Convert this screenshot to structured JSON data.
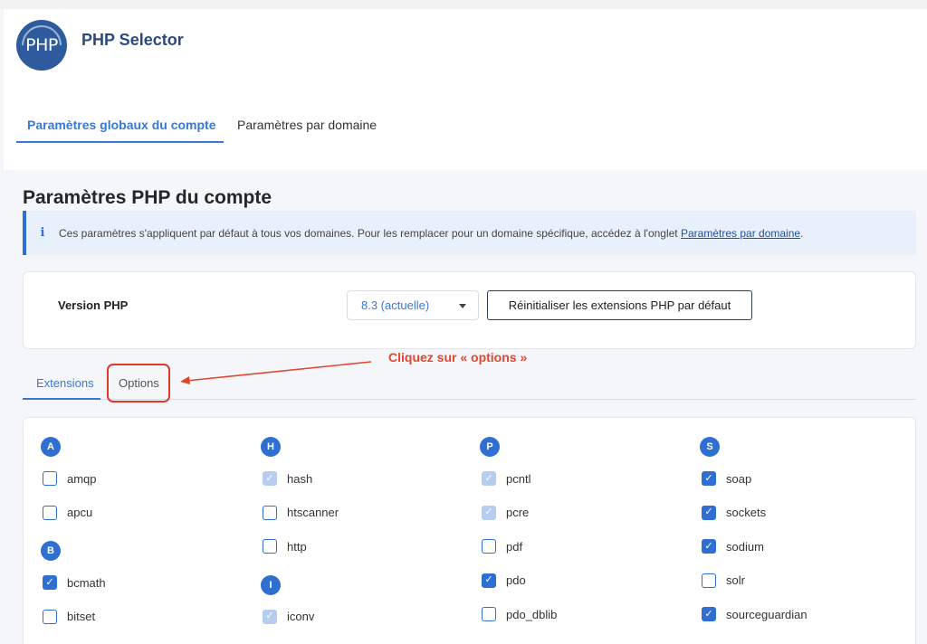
{
  "app": {
    "logo_text": "PHP",
    "title": "PHP Selector"
  },
  "top_tabs": [
    {
      "label": "Paramètres globaux du compte",
      "active": true
    },
    {
      "label": "Paramètres par domaine",
      "active": false
    }
  ],
  "page_title": "Paramètres PHP du compte",
  "info": {
    "icon": "info-icon",
    "text": "Ces paramètres s'appliquent par défaut à tous vos domaines. Pour les remplacer pour un domaine spécifique, accédez à l'onglet ",
    "link": "Paramètres par domaine",
    "suffix": "."
  },
  "version": {
    "label": "Version PHP",
    "selected": "8.3 (actuelle)",
    "reset_label": "Réinitialiser les extensions PHP par défaut"
  },
  "sub_tabs": [
    {
      "label": "Extensions",
      "active": true
    },
    {
      "label": "Options",
      "active": false
    }
  ],
  "annotation": "Cliquez sur « options »",
  "colors": {
    "accent": "#2f6fd1",
    "annotation": "#e0472f",
    "title": "#2b4a7f"
  },
  "extensions": {
    "col1": {
      "groups": [
        {
          "letter": "A",
          "items": [
            {
              "name": "amqp",
              "state": "unchecked"
            },
            {
              "name": "apcu",
              "state": "unchecked"
            }
          ]
        },
        {
          "letter": "B",
          "items": [
            {
              "name": "bcmath",
              "state": "checked"
            },
            {
              "name": "bitset",
              "state": "unchecked"
            }
          ]
        }
      ]
    },
    "col2": {
      "groups": [
        {
          "letter": "H",
          "items": [
            {
              "name": "hash",
              "state": "disabled"
            },
            {
              "name": "htscanner",
              "state": "unchecked"
            },
            {
              "name": "http",
              "state": "unchecked"
            }
          ]
        },
        {
          "letter": "I",
          "items": [
            {
              "name": "iconv",
              "state": "disabled"
            }
          ]
        }
      ]
    },
    "col3": {
      "groups": [
        {
          "letter": "P",
          "items": [
            {
              "name": "pcntl",
              "state": "disabled"
            },
            {
              "name": "pcre",
              "state": "disabled"
            },
            {
              "name": "pdf",
              "state": "unchecked"
            },
            {
              "name": "pdo",
              "state": "checked"
            },
            {
              "name": "pdo_dblib",
              "state": "unchecked"
            }
          ]
        }
      ]
    },
    "col4": {
      "groups": [
        {
          "letter": "S",
          "items": [
            {
              "name": "soap",
              "state": "checked"
            },
            {
              "name": "sockets",
              "state": "checked"
            },
            {
              "name": "sodium",
              "state": "checked"
            },
            {
              "name": "solr",
              "state": "unchecked"
            },
            {
              "name": "sourceguardian",
              "state": "checked"
            }
          ]
        }
      ]
    }
  }
}
